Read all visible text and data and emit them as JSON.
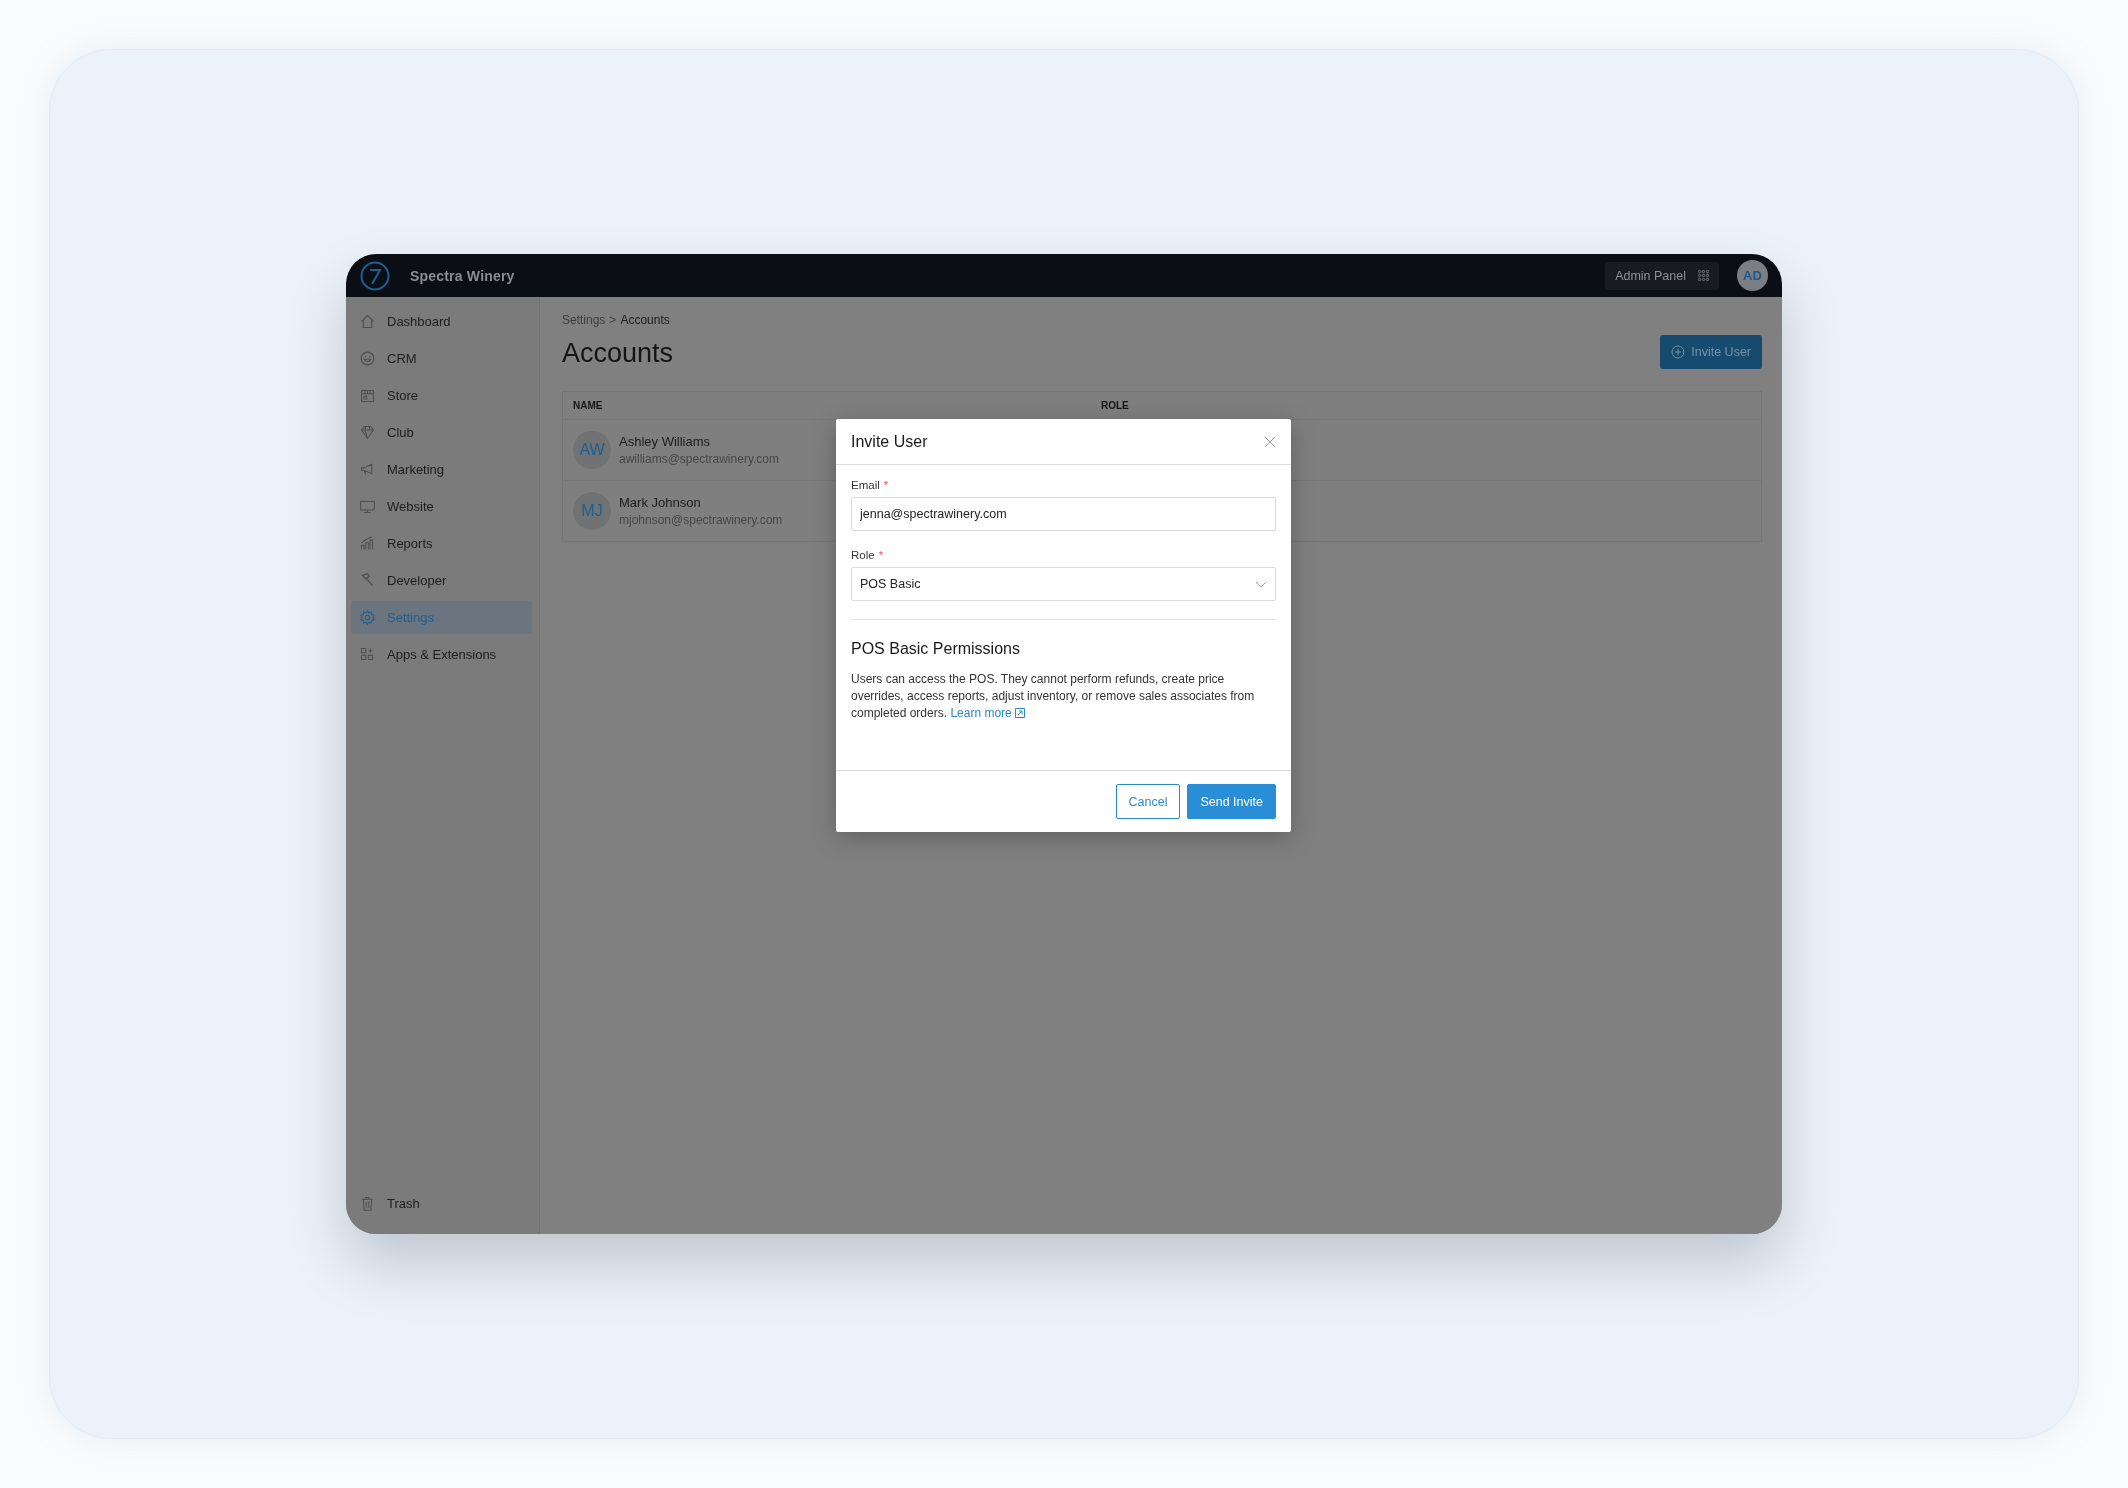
{
  "topbar": {
    "brand": "Spectra Winery",
    "admin_button": "Admin Panel",
    "avatar": "AD"
  },
  "sidebar": {
    "items": [
      {
        "label": "Dashboard",
        "selected": false
      },
      {
        "label": "CRM",
        "selected": false
      },
      {
        "label": "Store",
        "selected": false
      },
      {
        "label": "Club",
        "selected": false
      },
      {
        "label": "Marketing",
        "selected": false
      },
      {
        "label": "Website",
        "selected": false
      },
      {
        "label": "Reports",
        "selected": false
      },
      {
        "label": "Developer",
        "selected": false
      },
      {
        "label": "Settings",
        "selected": true
      },
      {
        "label": "Apps & Extensions",
        "selected": false
      }
    ],
    "footer_items": [
      {
        "label": "Trash",
        "selected": false
      }
    ]
  },
  "page": {
    "breadcrumb": {
      "items": [
        "Settings",
        "Accounts"
      ],
      "separator": ">"
    },
    "title": "Accounts",
    "invite_button": "Invite User",
    "table": {
      "columns": [
        "NAME",
        "ROLE"
      ],
      "rows": [
        {
          "initials": "AW",
          "name": "Ashley Williams",
          "email": "awilliams@spectrawinery.com"
        },
        {
          "initials": "MJ",
          "name": "Mark Johnson",
          "email": "mjohnson@spectrawinery.com"
        }
      ]
    }
  },
  "dialog": {
    "title": "Invite User",
    "fields": [
      {
        "kind": "text",
        "label": "Email",
        "required_mark": "*",
        "value": "jenna@spectrawinery.com"
      },
      {
        "kind": "select",
        "label": "Role",
        "required_mark": "*",
        "value": "POS Basic"
      }
    ],
    "section": {
      "heading": "POS Basic Permissions",
      "text": "Users can access the POS. They cannot perform refunds, create price overrides, access reports, adjust inventory, or remove sales associates from completed orders.",
      "link": "Learn more"
    },
    "buttons": [
      {
        "label": "Cancel",
        "kind": "secondary"
      },
      {
        "label": "Send Invite",
        "kind": "primary"
      }
    ]
  }
}
